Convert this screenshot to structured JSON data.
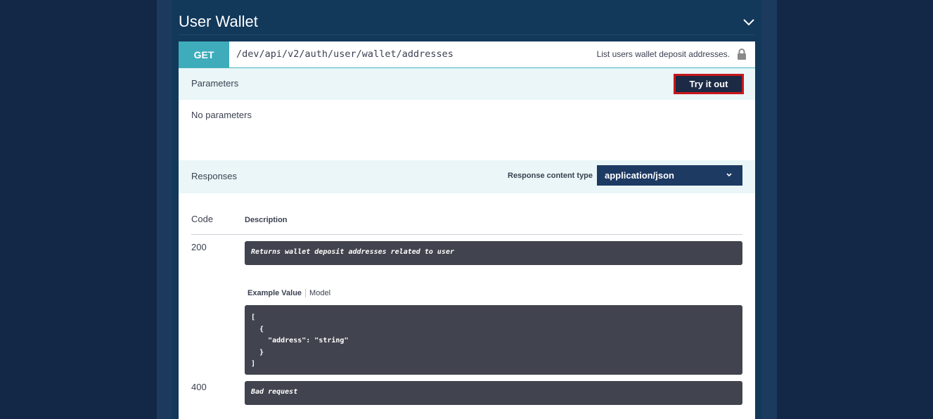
{
  "section": {
    "title": "User Wallet"
  },
  "operation": {
    "method": "GET",
    "path": "/dev/api/v2/auth/user/wallet/addresses",
    "description": "List users wallet deposit addresses."
  },
  "parameters": {
    "label": "Parameters",
    "try_button": "Try it out",
    "empty_text": "No parameters"
  },
  "responses": {
    "label": "Responses",
    "content_type_label": "Response content type",
    "content_type_value": "application/json",
    "table_headers": {
      "code": "Code",
      "description": "Description"
    },
    "rows": [
      {
        "code": "200",
        "description": "Returns wallet deposit addresses related to user",
        "tabs": {
          "example": "Example Value",
          "model": "Model"
        },
        "example": "[\n  {\n    \"address\": \"string\"\n  }\n]"
      },
      {
        "code": "400",
        "description": "Bad request"
      }
    ]
  },
  "icons": {
    "collapse": "chevron-down-icon",
    "lock": "lock-icon",
    "dropdown": "caret-down-icon"
  },
  "colors": {
    "method_get": "#3eacbb",
    "try_button_bg": "#1c2a45",
    "try_button_border": "#c8171b",
    "content_type_bg": "#1d3a63",
    "code_box_bg": "#41444e"
  }
}
